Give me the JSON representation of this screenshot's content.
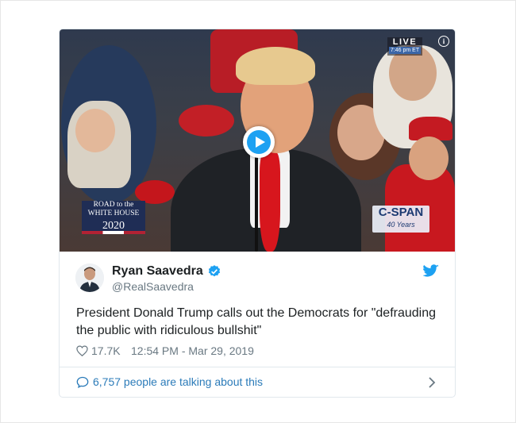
{
  "video": {
    "live_label": "LIVE",
    "live_time": "7:46 pm ET",
    "info_label": "i",
    "road_logo": {
      "line1": "ROAD to the",
      "line2": "WHITE HOUSE",
      "line3": "2020"
    },
    "cspan_logo": {
      "name": "C-SPAN",
      "sub": "40 Years"
    }
  },
  "tweet": {
    "display_name": "Ryan Saavedra",
    "handle": "@RealSaavedra",
    "text": "President Donald Trump calls out the Democrats for \"defrauding the public with ridiculous bullshit\"",
    "likes": "17.7K",
    "timestamp": "12:54 PM - Mar 29, 2019",
    "talking": "6,757 people are talking about this"
  },
  "colors": {
    "accent": "#1da1f2",
    "link": "#2b7bb9",
    "text": "#1c2022",
    "muted": "#697882",
    "border": "#e1e8ed"
  },
  "icons": [
    "info-icon",
    "play-icon",
    "verified-icon",
    "twitter-bird-icon",
    "heart-icon",
    "comment-icon",
    "chevron-right-icon"
  ]
}
